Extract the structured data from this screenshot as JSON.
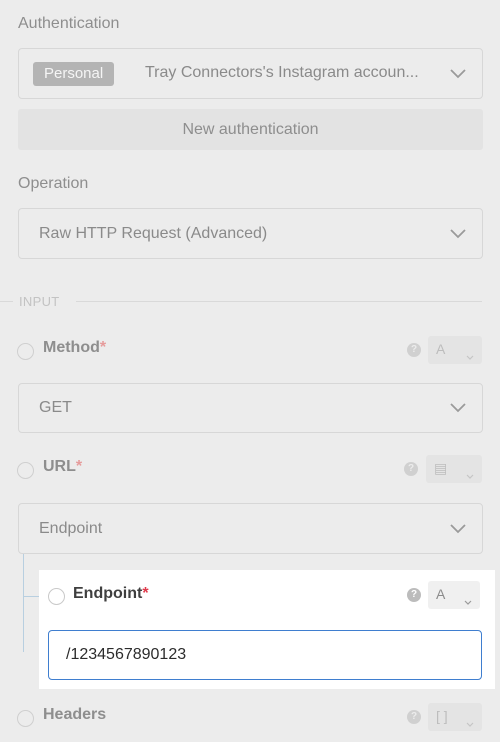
{
  "authentication": {
    "label": "Authentication",
    "badge": "Personal",
    "value": "Tray Connectors's Instagram accoun...",
    "new_button": "New authentication"
  },
  "operation": {
    "label": "Operation",
    "value": "Raw HTTP Request (Advanced)"
  },
  "input_section": {
    "label": "INPUT"
  },
  "fields": {
    "method": {
      "name": "Method",
      "required": "*",
      "value": "GET",
      "type_glyph": "A"
    },
    "url": {
      "name": "URL",
      "required": "*",
      "value": "Endpoint",
      "type_glyph": "▤"
    },
    "endpoint": {
      "name": "Endpoint",
      "required": "*",
      "value": "/1234567890123",
      "type_glyph": "A"
    },
    "headers": {
      "name": "Headers",
      "type_glyph": "[ ]"
    }
  },
  "icons": {
    "chevron": "chevron-down-icon",
    "help": "help-circle-icon",
    "radio": "radio-icon"
  },
  "colors": {
    "accent": "#3f7ecf",
    "required": "#e0394a",
    "overlay_bg": "#ececec"
  }
}
